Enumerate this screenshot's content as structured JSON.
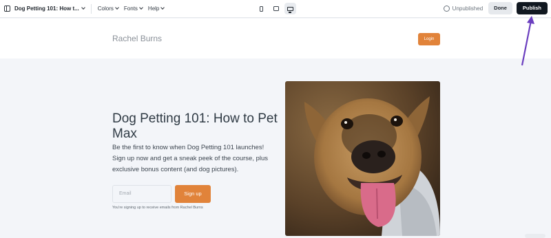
{
  "toolbar": {
    "page_title": "Dog Petting 101: How t...",
    "menus": [
      "Colors",
      "Fonts",
      "Help"
    ],
    "status": "Unpublished",
    "done_label": "Done",
    "publish_label": "Publish"
  },
  "site": {
    "brand": "Rachel Burns",
    "login_label": "Login"
  },
  "hero": {
    "title": "Dog Petting 101: How to Pet Max",
    "subtitle": "Be the first to know when Dog Petting 101 launches! Sign up now and get a sneak peek of the course, plus exclusive bonus content (and dog pictures).",
    "email_placeholder": "Email",
    "signup_label": "Sign up",
    "disclaimer": "You're signing up to receive emails from Rachel Burns"
  },
  "colors": {
    "accent": "#e1833a",
    "publish_bg": "#111820",
    "annotation_arrow": "#6b3fbf"
  }
}
